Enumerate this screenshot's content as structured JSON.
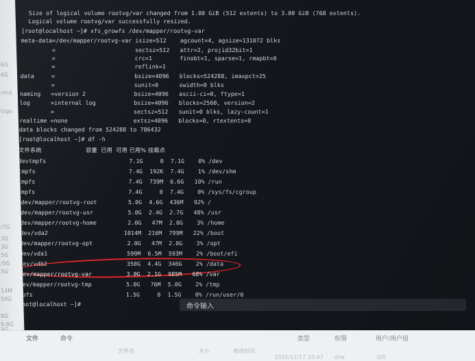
{
  "background_sizes": [
    "6G",
    "6G",
    "rmd",
    "logo",
    "/7G",
    "3G",
    "3G",
    "5G",
    "/5G",
    "5G",
    "14M",
    "50G",
    "8G",
    "9.8G",
    "3G",
    "/3G",
    "/5G",
    "1.5G"
  ],
  "terminal": {
    "lines": [
      "  Size of logical volume rootvg/var changed from 1.00 GiB (512 extents) to 3.00 GiB (768 extents).",
      "  Logical volume rootvg/var successfully resized.",
      "[root@localhost ~]# xfs_growfs /dev/mapper/rootvg-var",
      "meta-data=/dev/mapper/rootvg-var isize=512    agcount=4, agsize=131072 blks",
      "         =                       sectsz=512   attr=2, projid32bit=1",
      "         =                       crc=1        finobt=1, sparse=1, rmapbt=0",
      "         =                       reflink=1",
      "data     =                       bsize=4096   blocks=524288, imaxpct=25",
      "         =                       sunit=0      swidth=0 blks",
      "naming   =version 2              bsize=4096   ascii-ci=0, ftype=1",
      "log      =internal log           bsize=4096   blocks=2560, version=2",
      "         =                       sectsz=512   sunit=0 blks, lazy-count=1",
      "realtime =none                   extsz=4096   blocks=0, rtextents=0",
      "data blocks changed from 524288 to 786432",
      "[root@localhost ~]# df -h",
      "文件系统                        容量  已用  可用 已用% 挂载点",
      "devtmpfs                        7.1G     0  7.1G    0% /dev",
      "tmpfs                           7.4G  192K  7.4G    1% /dev/shm",
      "tmpfs                           7.4G  739M  6.6G   10% /run",
      "tmpfs                           7.4G     0  7.4G    0% /sys/fs/cgroup",
      "/dev/mapper/rootvg-root         5.0G  4.6G  436M   92% /",
      "/dev/mapper/rootvg-usr          5.0G  2.4G  2.7G   48% /usr",
      "/dev/mapper/rootvg-home         2.0G   47M  2.0G    3% /home",
      "/dev/vda2                      1014M  216M  799M   22% /boot",
      "/dev/mapper/rootvg-opt          2.0G   47M  2.0G    3% /opt",
      "/dev/vda1                       599M  6.5M  593M    2% /boot/efi",
      "/dev/vdb2                       350G  4.4G  346G    2% /data",
      "/dev/mapper/rootvg-var          3.0G  2.1G  985M   68% /var",
      "/dev/mapper/rootvg-tmp          5.0G   76M  5.0G    2% /tmp",
      "tmpfs                           1.5G     0  1.5G    0% /run/user/0",
      "[root@localhost ~]#"
    ],
    "highlighted_line_index": 27
  },
  "command_input": {
    "label": "命令输入"
  },
  "bottom_app": {
    "tabs": [
      "文件",
      "命令"
    ],
    "columns": [
      "类型",
      "权限",
      "用户/用户组"
    ],
    "faint_texts": [
      "文件名",
      "大小",
      "修改时间",
      "drw",
      "0/0"
    ],
    "modified_time": "2022/11/17 10:47"
  },
  "colors": {
    "terminal_bg": "#14171c",
    "terminal_text": "#d8dce2",
    "highlight_oval": "#e0262b",
    "bottom_bar_bg": "#eef0f2"
  }
}
